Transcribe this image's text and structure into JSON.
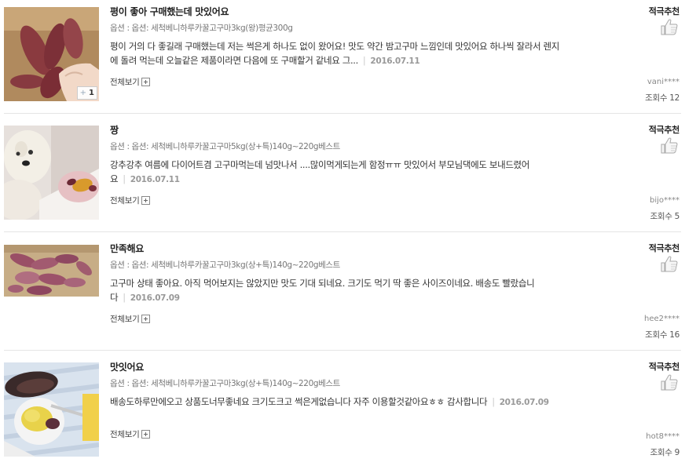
{
  "reviews": [
    {
      "title": "평이 좋아 구매했는데 맛있어요",
      "option": "옵션 : 옵션: 세척베니하루카꿀고구마3kg(왕)평균300g",
      "content": "평이 거의 다 좋길래 구매했는데 저는 썩은게 하나도 없이 왔어요! 맛도 약간 밤고구마 느낌인데 맛있어요 하나씩 잘라서 렌지에 돌려 먹는데 오늘같은 제품이라면 다음에 또 구매할거 같네요 그...",
      "date": "2016.07.11",
      "more_label": "전체보기",
      "photo_count": "1",
      "recommend_label": "적극추천",
      "user": "vani****",
      "views": "조회수 12",
      "thumb_icon": "thumbs-up-icon"
    },
    {
      "title": "짱",
      "option": "옵션 : 옵션: 세척베니하루카꿀고구마5kg(상+특)140g~220g베스트",
      "content": "강추강추 여름에 다이어트겸 고구마먹는데 넘맛나서 ....많이먹게되는게 함정ㅠㅠ 맛있어서 부모님댁에도 보내드렸어요",
      "date": "2016.07.11",
      "more_label": "전체보기",
      "recommend_label": "적극추천",
      "user": "bijo****",
      "views": "조회수 5",
      "thumb_icon": "thumbs-up-icon"
    },
    {
      "title": "만족해요",
      "option": "옵션 : 옵션: 세척베니하루카꿀고구마3kg(상+특)140g~220g베스트",
      "content": "고구마 상태 좋아요. 아직 먹어보지는 않았지만 맛도 기대 되네요. 크기도 먹기 딱 좋은 사이즈이네요. 배송도 빨랐습니다",
      "date": "2016.07.09",
      "more_label": "전체보기",
      "recommend_label": "적극추천",
      "user": "hee2****",
      "views": "조회수 16",
      "thumb_icon": "thumbs-up-icon"
    },
    {
      "title": "맛잇어요",
      "option": "옵션 : 옵션: 세척베니하루카꿀고구마3kg(상+특)140g~220g베스트",
      "content": "배송도하루만에오고 상품도너무좋네요 크기도크고 썩은게없습니다 자주 이용할것같아요ㅎㅎ 감사합니다",
      "date": "2016.07.09",
      "more_label": "전체보기",
      "recommend_label": "적극추천",
      "user": "hot8****",
      "views": "조회수 9",
      "thumb_icon": "thumbs-up-icon"
    }
  ]
}
